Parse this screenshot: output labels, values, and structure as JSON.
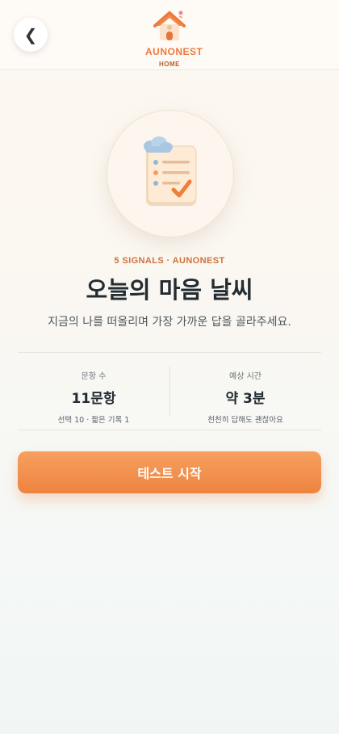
{
  "header": {
    "back_icon": "chevron-left-icon",
    "back_glyph": "❮",
    "brand": "AUNONEST",
    "brand_sub": "HOME"
  },
  "hero": {
    "icon": "checklist-clipboard-icon"
  },
  "intro": {
    "eyebrow": "5 SIGNALS · AUNONEST",
    "title": "오늘의 마음 날씨",
    "subtitle": "지금의 나를 떠올리며 가장 가까운 답을 골라주세요."
  },
  "stats": [
    {
      "label": "문항 수",
      "value": "11문항",
      "note": "선택 10 · 짧은 기록 1"
    },
    {
      "label": "예상 시간",
      "value": "약 3분",
      "note": "천천히 답해도 괜찮아요"
    }
  ],
  "start_button": {
    "label": "테스트 시작"
  },
  "colors": {
    "accent": "#ef7a3c",
    "button_top": "#f6a05f",
    "button_bottom": "#ee8340",
    "text_dark": "#232c33"
  }
}
